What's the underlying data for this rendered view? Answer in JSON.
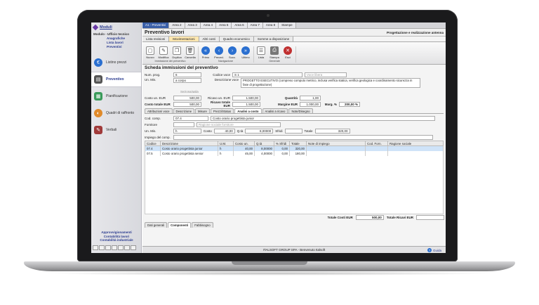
{
  "sidebar": {
    "modules_label": "Moduli",
    "module_name": "Modulo - Ufficio tecnico",
    "links": [
      "Anagrafiche",
      "Lista lavori",
      "Preventivi"
    ],
    "items": [
      {
        "label": "Listino prezzi",
        "icon": "price-list-icon",
        "color": "#2a6fd0"
      },
      {
        "label": "Preventivo",
        "icon": "estimate-icon",
        "color": "#555555",
        "active": true
      },
      {
        "label": "Pianificazione",
        "icon": "planning-icon",
        "color": "#3a9a5a"
      },
      {
        "label": "Quadri di raffronto",
        "icon": "comparison-icon",
        "color": "#e08a2a"
      },
      {
        "label": "Verbali",
        "icon": "minutes-icon",
        "color": "#a03a3a"
      }
    ],
    "bottom_links": [
      "Approvvigionamenti",
      "Contabilità lavori",
      "Contabilità industriale"
    ]
  },
  "top_tabs": [
    "A1 - Preventivi",
    "Area 2",
    "Area 3",
    "Area 4",
    "Area 5",
    "Area 6",
    "Area 7",
    "Area 8",
    "Stampe"
  ],
  "title": "Preventivo lavori",
  "title_right": "Progettazione e realizzazione antenna",
  "section_tabs": [
    "Lista revisioni",
    "Movimentazioni",
    "Altri costi",
    "Quadro economico",
    "Somme a disposizione"
  ],
  "toolbar": {
    "group1": {
      "label": "Immissione dei preventivo",
      "buttons": [
        "Nuovo",
        "Modifica",
        "Duplica",
        "Cancella"
      ]
    },
    "group2": {
      "label": "Navigazione",
      "buttons": [
        "Primo",
        "Preced.",
        "Succ.",
        "Ultimo"
      ]
    },
    "group3": {
      "label": "Generale",
      "buttons": [
        "Lista",
        "Stampa",
        "Esci"
      ]
    }
  },
  "section_title": "Scheda immissioni del preventivo",
  "form": {
    "num_prog_label": "Num. prog.",
    "num_prog": "6",
    "codice_voce_label": "Codice voce",
    "codice_voce": "S  1",
    "voce_libera": "Voce libera",
    "um_label": "Un. Mis.",
    "um": "a corpo",
    "descr_label": "Descrizione voce",
    "descr": "PROGETTO ESECUTIVO (compreso computo metrico, inclusa verifica statica, verifica geologica e coordinamento sicurezza in fase di progettazione)",
    "seziona": "Seziona/aalia",
    "costo_un_label": "Costo un.  EUR",
    "costo_un": "500,00",
    "ricavo_un_label": "Ricavo un.  EUR",
    "ricavo_un": "1.500,00",
    "quantita_label": "Quantità",
    "quantita": "1,00",
    "costo_tot_label": "Costo totale  EUR",
    "costo_tot": "500,00",
    "ricavo_tot_label": "Ricavo totale  EUR",
    "ricavo_tot": "1.500,00",
    "margine_label": "Margine  EUR",
    "margine": "1.000,00",
    "marg_pct_label": "Marg. %",
    "marg_pct": "200,00 %"
  },
  "sub_tabs": [
    "Attribuzioni voce",
    "Descrizione",
    "Misure",
    "Prezzi/Status",
    "Analisi a costo",
    "Analisi a ricavo",
    "Note/Disegno"
  ],
  "sub_tab_active": "Analisi a costo",
  "comp": {
    "cod_label": "Cod. comp.",
    "cod": "07.4",
    "descr": "Costo orario progettista junior",
    "fornitore_label": "Fornitore",
    "rag_soc": "Ragione sociale fornitore",
    "um_label": "Un. Mis.",
    "um": "h",
    "costo_label": "Costo",
    "costo": "40,00",
    "qta_label": "Q.tà",
    "qta": "8,00000",
    "sfridi_label": "Sfridi",
    "totale_label": "Totale",
    "totale": "320,00",
    "impiego_label": "Impiego del comp."
  },
  "table": {
    "headers": [
      "Codice",
      "Descrizione",
      "U.M.",
      "Costo un.",
      "Q.tà",
      "% Sfridi",
      "Totale",
      "Note di impiego",
      "Cod. Forn.",
      "Ragione sociale"
    ],
    "rows": [
      [
        "07.4",
        "Costo orario progettista junior",
        "h",
        "40,00",
        "8,00000",
        "0,00",
        "320,00",
        "",
        "",
        ""
      ],
      [
        "07.5",
        "Costo orario progettista senior",
        "h",
        "45,00",
        "4,00000",
        "0,00",
        "180,00",
        "",
        "",
        ""
      ]
    ]
  },
  "totals": {
    "costi_label": "Totale Costi EUR",
    "costi": "500,00",
    "ricavi_label": "Totale Ricavi EUR"
  },
  "bottom_tabs": [
    "Dati generali",
    "Componenti",
    "Fabbisogno"
  ],
  "status_text": "ITALSOFT GROUP SPA - Benvenuto Italsoft",
  "guide_label": "Guida"
}
